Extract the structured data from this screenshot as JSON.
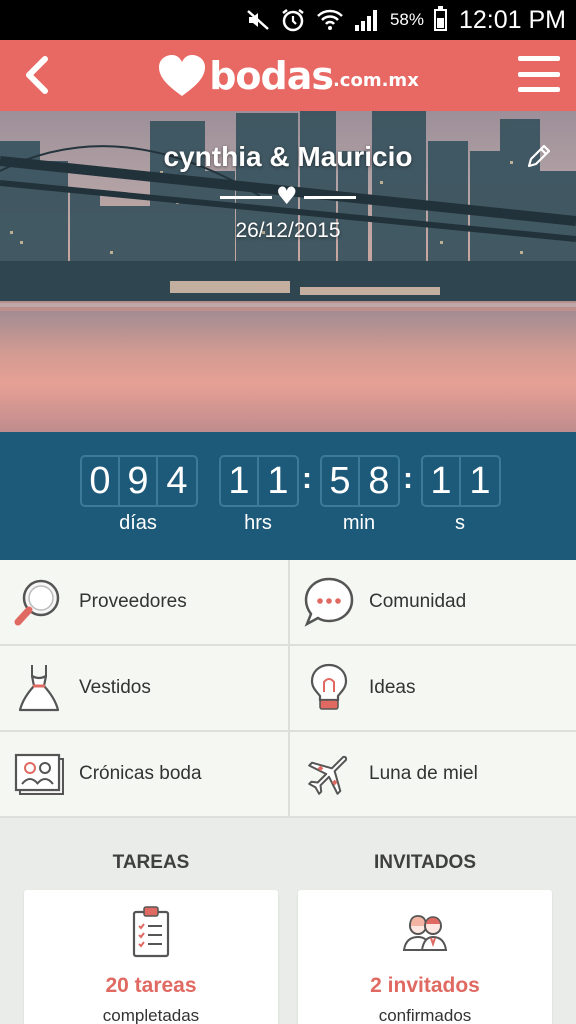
{
  "status_bar": {
    "battery_percent": "58%",
    "time": "12:01 PM",
    "icons": [
      "mute-icon",
      "alarm-icon",
      "wifi-icon",
      "signal-icon",
      "battery-icon"
    ]
  },
  "header": {
    "brand": "bodas",
    "brand_tld": ".com.mx",
    "back_icon": "chevron-left-icon",
    "menu_icon": "hamburger-menu-icon",
    "background_color": "#e86863"
  },
  "hero": {
    "couple_names": "cynthia & Mauricio",
    "wedding_date": "26/12/2015",
    "edit_icon": "pencil-icon"
  },
  "countdown": {
    "background_color": "#1d5a79",
    "days": [
      "0",
      "9",
      "4"
    ],
    "hours": [
      "1",
      "1"
    ],
    "minutes": [
      "5",
      "8"
    ],
    "seconds": [
      "1",
      "1"
    ],
    "separator": ":",
    "labels": {
      "days": "días",
      "hours": "hrs",
      "minutes": "min",
      "seconds": "s"
    }
  },
  "menu": {
    "items": [
      {
        "label": "Proveedores",
        "icon": "magnifier-icon"
      },
      {
        "label": "Comunidad",
        "icon": "chat-bubble-icon"
      },
      {
        "label": "Vestidos",
        "icon": "dress-icon"
      },
      {
        "label": "Ideas",
        "icon": "lightbulb-icon"
      },
      {
        "label": "Crónicas boda",
        "icon": "photo-album-icon"
      },
      {
        "label": "Luna de miel",
        "icon": "airplane-icon"
      }
    ]
  },
  "summary": {
    "tasks": {
      "title": "TAREAS",
      "count_text": "20 tareas",
      "status_text": "completadas",
      "icon": "clipboard-checklist-icon"
    },
    "guests": {
      "title": "INVITADOS",
      "count_text": "2 invitados",
      "status_text": "confirmados",
      "icon": "couple-icon"
    },
    "accent_color": "#e06a62"
  }
}
